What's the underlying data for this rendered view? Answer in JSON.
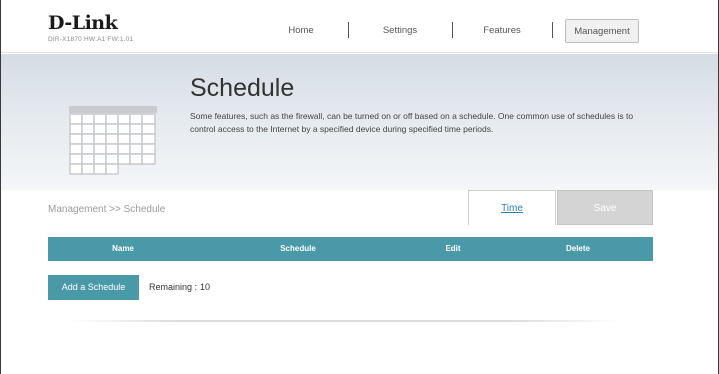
{
  "brand": {
    "logo": "D-Link",
    "model_info": "DIR-X1870 HW:A1 FW:1.01"
  },
  "nav": {
    "items": [
      {
        "label": "Home"
      },
      {
        "label": "Settings"
      },
      {
        "label": "Features"
      },
      {
        "label": "Management",
        "active": true
      }
    ]
  },
  "banner": {
    "title": "Schedule",
    "description": "Some features, such as the firewall, can be turned on or off based on a schedule. One common use of schedules is to control access to the Internet by a specified device during specified time periods.",
    "icon": "calendar-icon"
  },
  "breadcrumb": "Management >> Schedule",
  "toolbar": {
    "time_label": "Time",
    "save_label": "Save"
  },
  "table": {
    "columns": [
      "Name",
      "Schedule",
      "Edit",
      "Delete"
    ],
    "rows": []
  },
  "actions": {
    "add_label": "Add a Schedule",
    "remaining_label": "Remaining :",
    "remaining_value": "10"
  },
  "colors": {
    "accent": "#4a99a9",
    "link": "#2b7fb3",
    "save_disabled": "#d4d4d4"
  }
}
